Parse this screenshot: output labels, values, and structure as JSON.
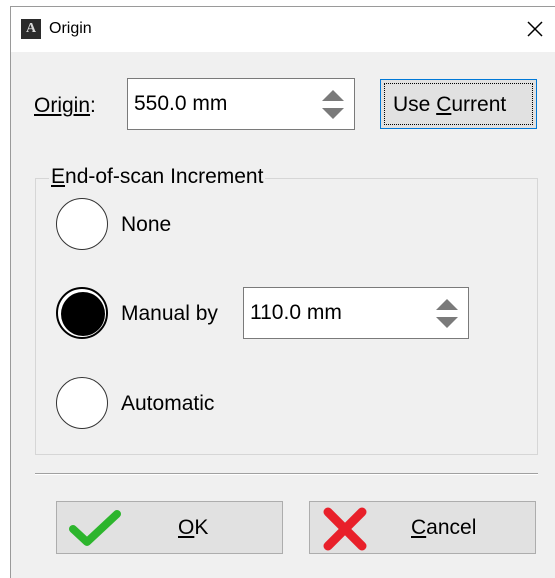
{
  "window": {
    "title": "Origin",
    "app_icon_letter": "A"
  },
  "origin": {
    "label_prefix": "Origin",
    "label_suffix": ":",
    "value": "550.0 mm"
  },
  "use_current": {
    "label_pre": "Use ",
    "label_accel": "C",
    "label_post": "urrent"
  },
  "increment": {
    "group_accel": "E",
    "group_rest": "nd-of-scan Increment",
    "options": [
      {
        "label": "None",
        "checked": false
      },
      {
        "label": "Manual by",
        "checked": true
      },
      {
        "label": "Automatic",
        "checked": false
      }
    ],
    "manual_value": "110.0 mm"
  },
  "buttons": {
    "ok_accel": "O",
    "ok_rest": "K",
    "cancel_accel": "C",
    "cancel_rest": "ancel",
    "ok_icon": "checkmark-icon",
    "cancel_icon": "red-x-icon"
  },
  "colors": {
    "ok_check": "#2db52d",
    "cancel_x": "#e8202a",
    "focus_border": "#0078d7"
  }
}
